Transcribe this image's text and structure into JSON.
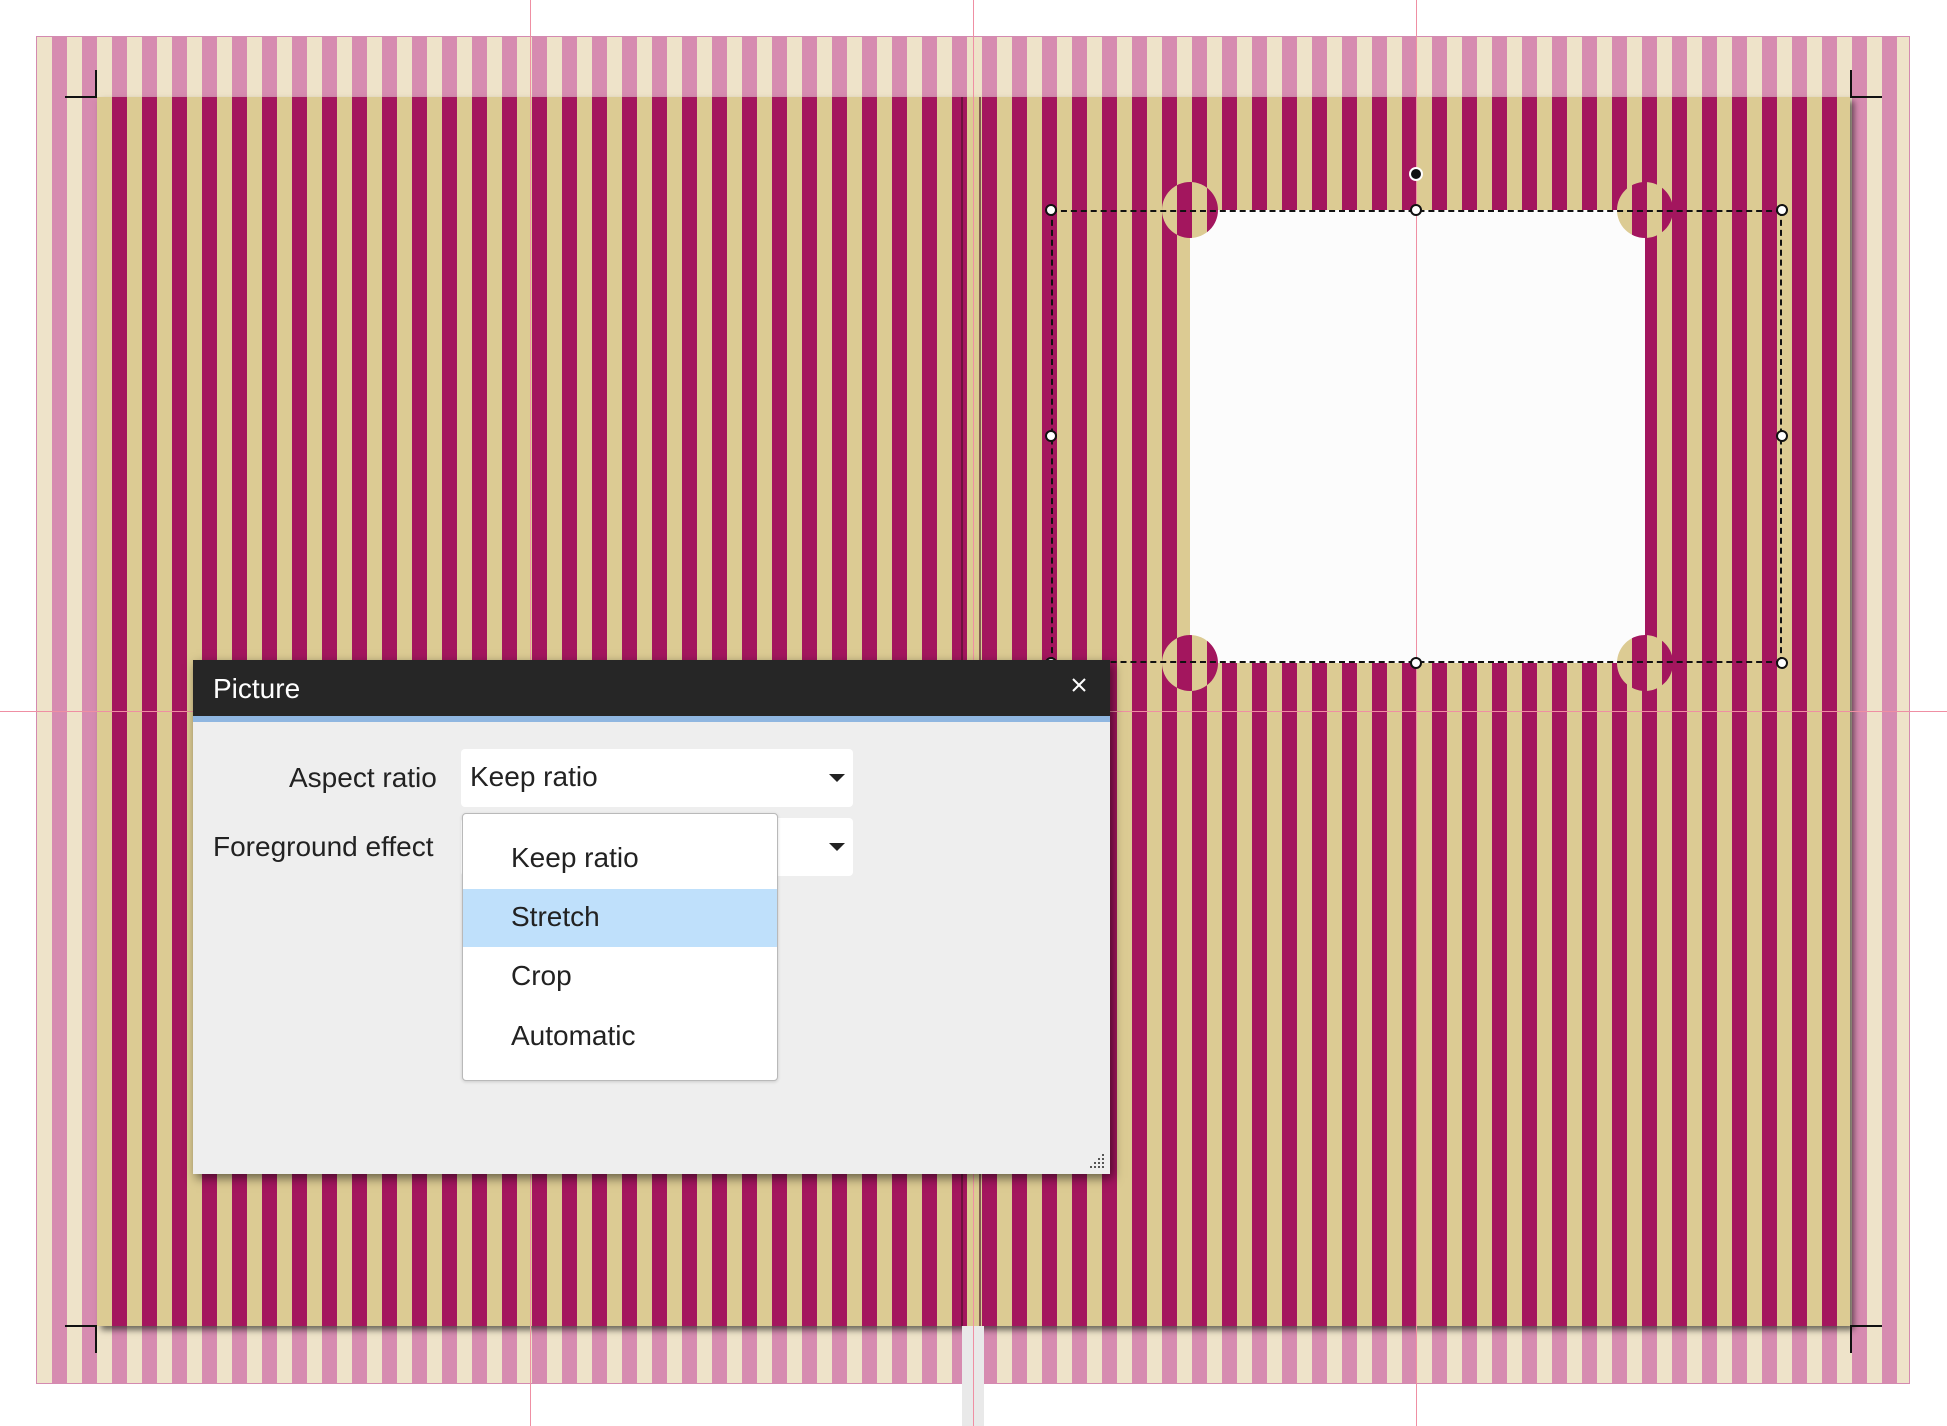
{
  "dialog": {
    "title": "Picture",
    "close_icon": "close-icon",
    "aspect_ratio": {
      "label": "Aspect ratio",
      "value": "Keep ratio"
    },
    "foreground_effect": {
      "label": "Foreground effect",
      "value": ""
    },
    "dropdown": {
      "options": [
        "Keep ratio",
        "Stretch",
        "Crop",
        "Automatic"
      ],
      "highlighted": "Stretch"
    }
  },
  "colors": {
    "stripe_dark": "#a3165e",
    "stripe_light": "#dccb93",
    "bleed_dark": "#d68bb0",
    "bleed_light": "#eee3c9",
    "titlebar": "#262626",
    "highlight": "#bfe0fb",
    "guide": "#ef8fa3"
  }
}
